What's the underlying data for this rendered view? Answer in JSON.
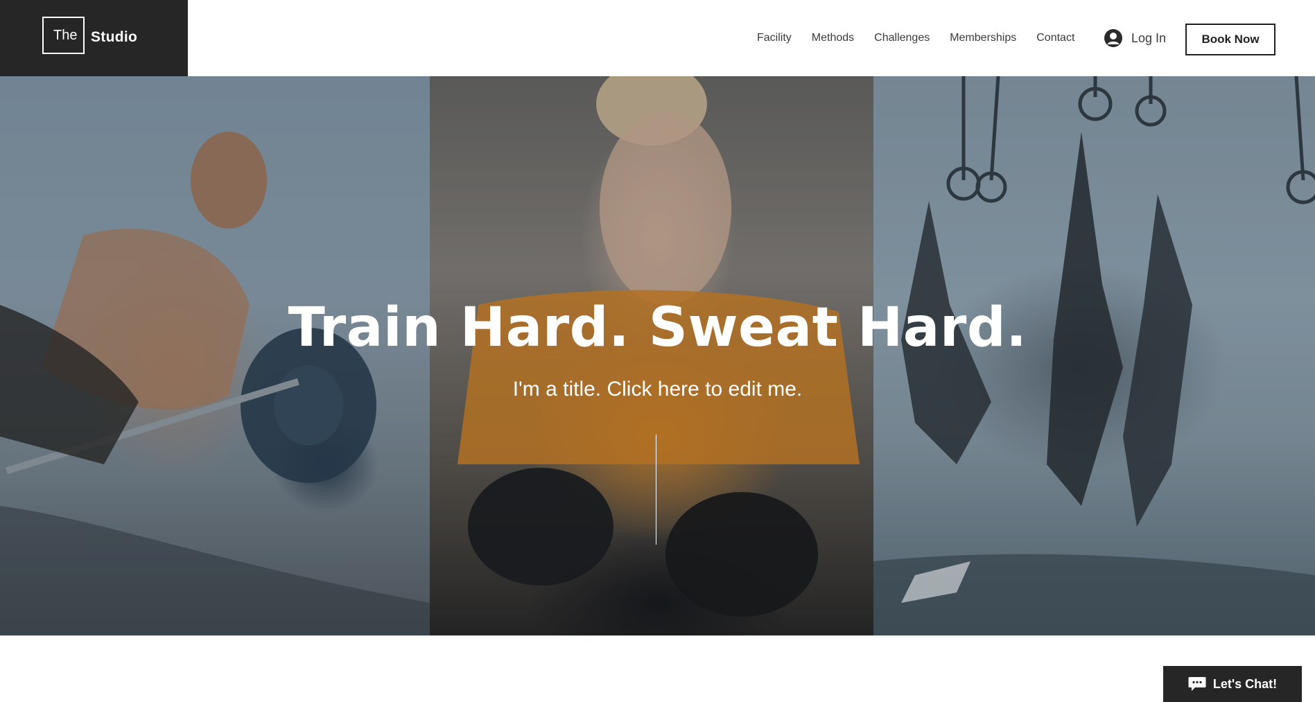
{
  "logo": {
    "box_text": "The",
    "text": "Studio"
  },
  "nav": {
    "items": [
      {
        "label": "Facility"
      },
      {
        "label": "Methods"
      },
      {
        "label": "Challenges"
      },
      {
        "label": "Memberships"
      },
      {
        "label": "Contact"
      }
    ]
  },
  "auth": {
    "login_label": "Log In",
    "avatar_icon": "user-circle-icon"
  },
  "cta": {
    "book_label": "Book Now"
  },
  "hero": {
    "title": "Train Hard. Sweat Hard.",
    "subtitle": "I'm a title. Click here to edit me."
  },
  "chat": {
    "label": "Let's Chat!",
    "icon": "chat-bubble-icon"
  },
  "colors": {
    "dark": "#262626",
    "white": "#ffffff",
    "text": "#3a3a3a"
  }
}
